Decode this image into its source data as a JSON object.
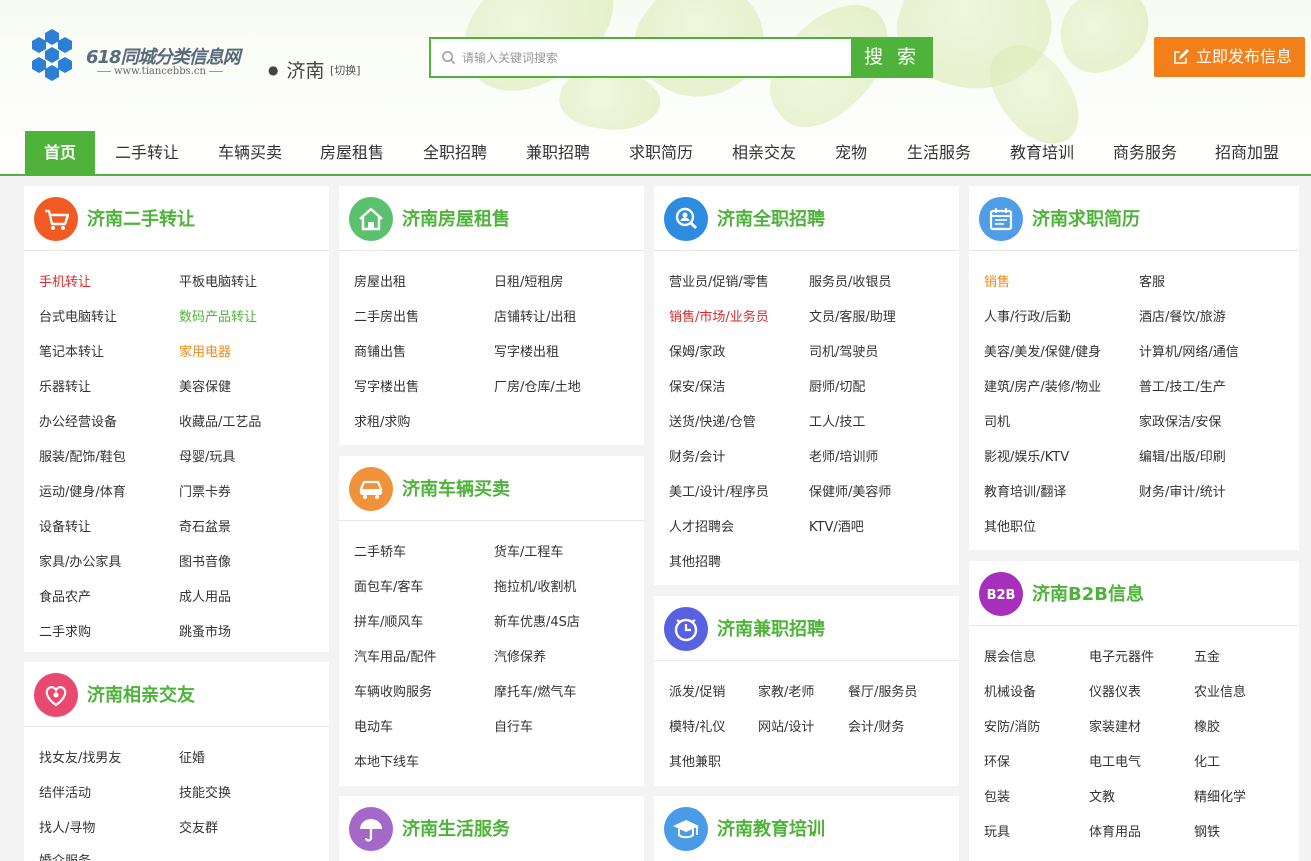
{
  "site": {
    "logo_title": "618同城分类信息网",
    "logo_sub": "www.tiancebbs.cn"
  },
  "city": {
    "name": "济南",
    "switch": "[切换]"
  },
  "search": {
    "placeholder": "请输入关键词搜索",
    "button": "搜 索"
  },
  "publish": {
    "label": "立即发布信息"
  },
  "colors": {
    "accent": "#4fb33b",
    "publish": "#f27f1a",
    "hot_red": "#d82b2b",
    "hot_orange": "#ef8a1c"
  },
  "nav": [
    "首页",
    "二手转让",
    "车辆买卖",
    "房屋租售",
    "全职招聘",
    "兼职招聘",
    "求职简历",
    "相亲交友",
    "宠物",
    "生活服务",
    "教育培训",
    "商务服务",
    "招商加盟"
  ],
  "panels": {
    "secondhand": {
      "icon": "cart-icon",
      "title": "济南二手转让",
      "links": [
        "手机转让",
        "平板电脑转让",
        "台式电脑转让",
        "数码产品转让",
        "笔记本转让",
        "家用电器",
        "乐器转让",
        "美容保健",
        "办公经营设备",
        "收藏品/工艺品",
        "服装/配饰/鞋包",
        "母婴/玩具",
        "运动/健身/体育",
        "门票卡券",
        "设备转让",
        "奇石盆景",
        "家具/办公家具",
        "图书音像",
        "食品农产",
        "成人用品",
        "二手求购",
        "跳蚤市场"
      ]
    },
    "dating": {
      "icon": "heart-icon",
      "title": "济南相亲交友",
      "links": [
        "找女友/找男友",
        "征婚",
        "结伴活动",
        "技能交换",
        "找人/寻物",
        "交友群",
        "婚介服务"
      ]
    },
    "house": {
      "icon": "house-icon",
      "title": "济南房屋租售",
      "links": [
        "房屋出租",
        "日租/短租房",
        "二手房出售",
        "店铺转让/出租",
        "商铺出售",
        "写字楼出租",
        "写字楼出售",
        "厂房/仓库/土地",
        "求租/求购"
      ]
    },
    "car": {
      "icon": "car-icon",
      "title": "济南车辆买卖",
      "links": [
        "二手轿车",
        "货车/工程车",
        "面包车/客车",
        "拖拉机/收割机",
        "拼车/顺风车",
        "新车优惠/4S店",
        "汽车用品/配件",
        "汽修保养",
        "车辆收购服务",
        "摩托车/燃气车",
        "电动车",
        "自行车",
        "本地下线车"
      ]
    },
    "life": {
      "icon": "umbrella-icon",
      "title": "济南生活服务"
    },
    "fulltime": {
      "icon": "magnifier-person-icon",
      "title": "济南全职招聘",
      "links": [
        "营业员/促销/零售",
        "服务员/收银员",
        "销售/市场/业务员",
        "文员/客服/助理",
        "保姆/家政",
        "司机/驾驶员",
        "保安/保洁",
        "厨师/切配",
        "送货/快递/仓管",
        "工人/技工",
        "财务/会计",
        "老师/培训师",
        "美工/设计/程序员",
        "保健师/美容师",
        "人才招聘会",
        "KTV/酒吧",
        "其他招聘"
      ]
    },
    "parttime": {
      "icon": "clock-icon",
      "title": "济南兼职招聘",
      "links": [
        "派发/促销",
        "家教/老师",
        "餐厅/服务员",
        "模特/礼仪",
        "网站/设计",
        "会计/财务",
        "其他兼职"
      ]
    },
    "education": {
      "icon": "graduation-cap-icon",
      "title": "济南教育培训"
    },
    "resume": {
      "icon": "calendar-icon",
      "title": "济南求职简历",
      "links": [
        "销售",
        "客服",
        "人事/行政/后勤",
        "酒店/餐饮/旅游",
        "美容/美发/保健/健身",
        "计算机/网络/通信",
        "建筑/房产/装修/物业",
        "普工/技工/生产",
        "司机",
        "家政保洁/安保",
        "影视/娱乐/KTV",
        "编辑/出版/印刷",
        "教育培训/翻译",
        "财务/审计/统计",
        "其他职位"
      ]
    },
    "b2b": {
      "icon": "b2b-icon",
      "icon_text": "B2B",
      "title": "济南B2B信息",
      "links": [
        "展会信息",
        "电子元器件",
        "五金",
        "机械设备",
        "仪器仪表",
        "农业信息",
        "安防/消防",
        "家装建材",
        "橡胶",
        "环保",
        "电工电气",
        "化工",
        "包装",
        "文教",
        "精细化学",
        "玩具",
        "体育用品",
        "钢铁"
      ]
    }
  }
}
